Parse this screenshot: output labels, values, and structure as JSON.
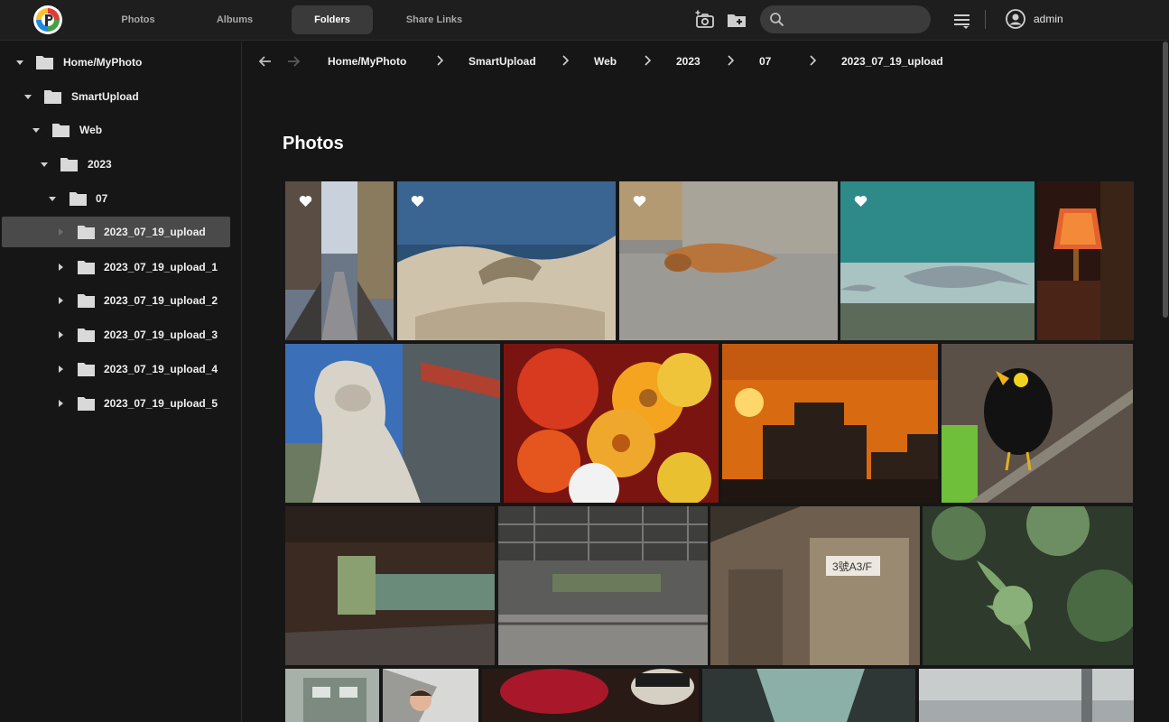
{
  "topbar": {
    "tabs": [
      {
        "label": "Photos",
        "active": false
      },
      {
        "label": "Albums",
        "active": false
      },
      {
        "label": "Folders",
        "active": true
      },
      {
        "label": "Share Links",
        "active": false
      }
    ],
    "search": {
      "placeholder": "",
      "value": ""
    },
    "icons": [
      "add-photo-icon",
      "add-folder-icon",
      "search-icon",
      "sort-icon",
      "user-icon"
    ],
    "user": "admin"
  },
  "sidebar": {
    "items": [
      {
        "label": "Home/MyPhoto",
        "expanded": true,
        "selected": false
      },
      {
        "label": "SmartUpload",
        "expanded": true,
        "selected": false
      },
      {
        "label": "Web",
        "expanded": true,
        "selected": false
      },
      {
        "label": "2023",
        "expanded": true,
        "selected": false
      },
      {
        "label": "07",
        "expanded": true,
        "selected": false
      },
      {
        "label": "2023_07_19_upload",
        "expanded": false,
        "selected": true
      },
      {
        "label": "2023_07_19_upload_1",
        "expanded": false,
        "selected": false
      },
      {
        "label": "2023_07_19_upload_2",
        "expanded": false,
        "selected": false
      },
      {
        "label": "2023_07_19_upload_3",
        "expanded": false,
        "selected": false
      },
      {
        "label": "2023_07_19_upload_4",
        "expanded": false,
        "selected": false
      },
      {
        "label": "2023_07_19_upload_5",
        "expanded": false,
        "selected": false
      }
    ]
  },
  "breadcrumb": [
    "Home/MyPhoto",
    "SmartUpload",
    "Web",
    "2023",
    "07",
    "2023_07_19_upload"
  ],
  "main": {
    "section_title": "Photos"
  },
  "photos": [
    {
      "subject": "street-alley",
      "favorite": true
    },
    {
      "subject": "sea-rocks",
      "favorite": true
    },
    {
      "subject": "sleeping-dog",
      "favorite": true
    },
    {
      "subject": "aquarium-shark",
      "favorite": true
    },
    {
      "subject": "wall-lamp",
      "favorite": false
    },
    {
      "subject": "stone-lion-temple",
      "favorite": false
    },
    {
      "subject": "flowers-bouquet",
      "favorite": false
    },
    {
      "subject": "sunset-skyline",
      "favorite": false
    },
    {
      "subject": "myna-bird",
      "favorite": false
    },
    {
      "subject": "underpass",
      "favorite": false
    },
    {
      "subject": "parking-ceiling",
      "favorite": false
    },
    {
      "subject": "mailboxes",
      "favorite": false,
      "caption_text": "3號A3/F"
    },
    {
      "subject": "fern-leaves",
      "favorite": false
    },
    {
      "subject": "building-street",
      "favorite": false
    },
    {
      "subject": "child-portrait",
      "favorite": false
    },
    {
      "subject": "sushi",
      "favorite": false
    },
    {
      "subject": "walkway-canopy",
      "favorite": false
    },
    {
      "subject": "foggy-harbor",
      "favorite": false
    }
  ],
  "colors": {
    "background": "#161616",
    "topbar": "#1e1e1e",
    "active_tab": "#3a3a3a",
    "selected_item": "#4a4a4a",
    "search_bg": "#3b3b3b"
  }
}
